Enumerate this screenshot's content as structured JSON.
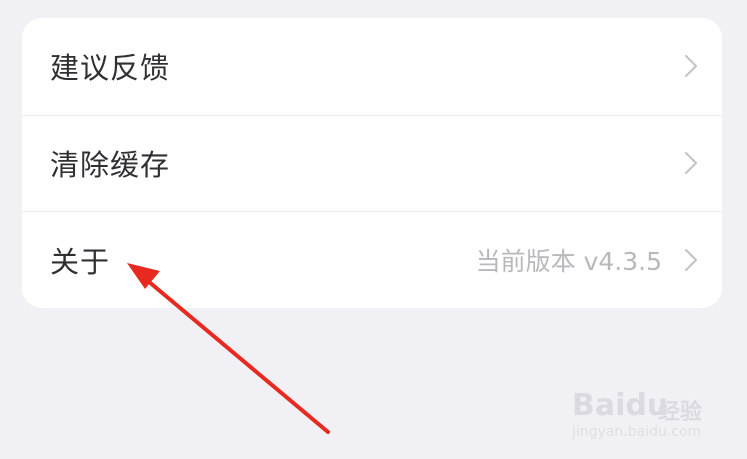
{
  "settings": {
    "items": [
      {
        "label": "建议反馈",
        "value": ""
      },
      {
        "label": "清除缓存",
        "value": ""
      },
      {
        "label": "关于",
        "value": "当前版本 v4.3.5"
      }
    ]
  },
  "colors": {
    "background": "#f1f1f5",
    "card": "#ffffff",
    "label": "#303034",
    "muted": "#b8b8bd",
    "annotation_arrow": "#e8291f"
  },
  "icons": {
    "row_chevron": "chevron-right-icon"
  },
  "watermark": {
    "logo": "Baidu",
    "name": "经验",
    "url": "jingyan.baidu.com"
  }
}
